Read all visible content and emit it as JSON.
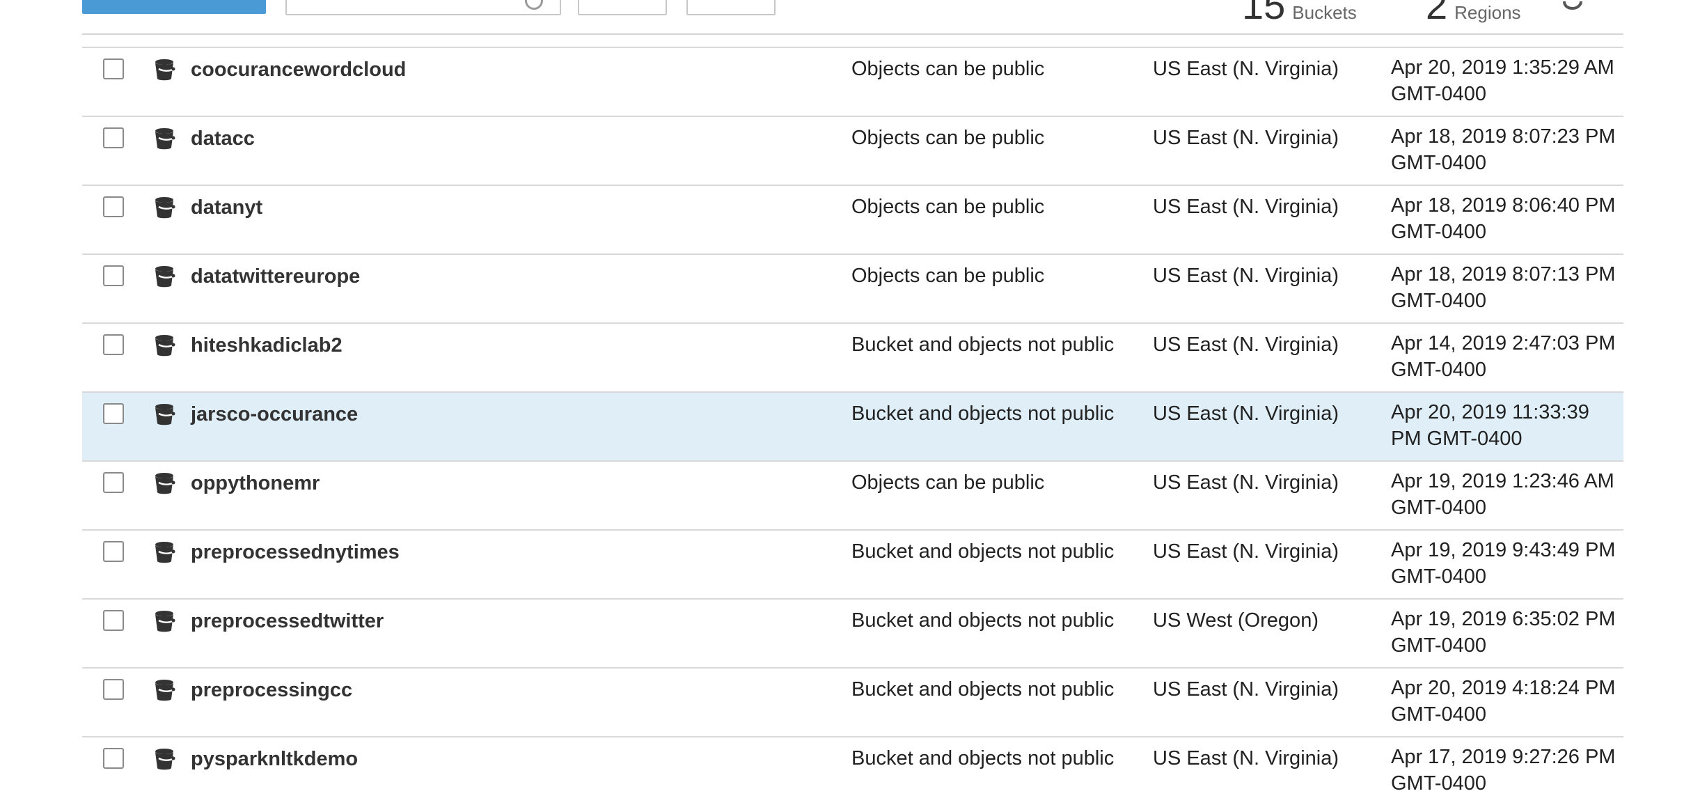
{
  "toolbar": {
    "stats": [
      {
        "value": "15",
        "unit": "Buckets"
      },
      {
        "value": "2",
        "unit": "Regions"
      }
    ]
  },
  "buckets": [
    {
      "name": "coocurancewordcloud",
      "access": "Objects can be public",
      "region": "US East (N. Virginia)",
      "created": "Apr 20, 2019 1:35:29 AM GMT-0400",
      "selected": false
    },
    {
      "name": "datacc",
      "access": "Objects can be public",
      "region": "US East (N. Virginia)",
      "created": "Apr 18, 2019 8:07:23 PM GMT-0400",
      "selected": false
    },
    {
      "name": "datanyt",
      "access": "Objects can be public",
      "region": "US East (N. Virginia)",
      "created": "Apr 18, 2019 8:06:40 PM GMT-0400",
      "selected": false
    },
    {
      "name": "datatwittereurope",
      "access": "Objects can be public",
      "region": "US East (N. Virginia)",
      "created": "Apr 18, 2019 8:07:13 PM GMT-0400",
      "selected": false
    },
    {
      "name": "hiteshkadiclab2",
      "access": "Bucket and objects not public",
      "region": "US East (N. Virginia)",
      "created": "Apr 14, 2019 2:47:03 PM GMT-0400",
      "selected": false
    },
    {
      "name": "jarsco-occurance",
      "access": "Bucket and objects not public",
      "region": "US East (N. Virginia)",
      "created": "Apr 20, 2019 11:33:39 PM GMT-0400",
      "selected": true
    },
    {
      "name": "oppythonemr",
      "access": "Objects can be public",
      "region": "US East (N. Virginia)",
      "created": "Apr 19, 2019 1:23:46 AM GMT-0400",
      "selected": false
    },
    {
      "name": "preprocessednytimes",
      "access": "Bucket and objects not public",
      "region": "US East (N. Virginia)",
      "created": "Apr 19, 2019 9:43:49 PM GMT-0400",
      "selected": false
    },
    {
      "name": "preprocessedtwitter",
      "access": "Bucket and objects not public",
      "region": "US West (Oregon)",
      "created": "Apr 19, 2019 6:35:02 PM GMT-0400",
      "selected": false
    },
    {
      "name": "preprocessingcc",
      "access": "Bucket and objects not public",
      "region": "US East (N. Virginia)",
      "created": "Apr 20, 2019 4:18:24 PM GMT-0400",
      "selected": false
    },
    {
      "name": "pysparknltkdemo",
      "access": "Bucket and objects not public",
      "region": "US East (N. Virginia)",
      "created": "Apr 17, 2019 9:27:26 PM GMT-0400",
      "selected": false
    }
  ],
  "colors": {
    "primary": "#4a9ad6",
    "selected_row": "#dfeef7",
    "divider": "#d9d9d9"
  }
}
